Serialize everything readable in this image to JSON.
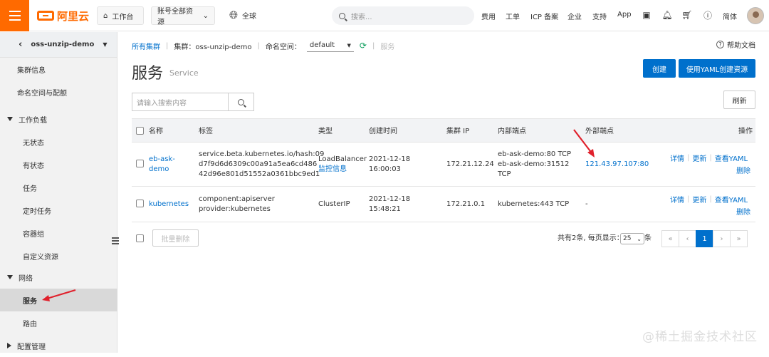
{
  "topbar": {
    "logo_text": "阿里云",
    "workbench": "工作台",
    "account_scope": "账号全部资源",
    "region": "全球",
    "search_placeholder": "搜索...",
    "links": [
      "费用",
      "工单",
      "ICP 备案",
      "企业",
      "支持",
      "App"
    ],
    "lang": "简体"
  },
  "sidebar": {
    "cluster_name": "oss-unzip-demo",
    "items": [
      {
        "label": "集群信息",
        "kind": "top"
      },
      {
        "label": "命名空间与配额",
        "kind": "top"
      },
      {
        "label": "工作负载",
        "kind": "group-open"
      },
      {
        "label": "无状态",
        "kind": "sub"
      },
      {
        "label": "有状态",
        "kind": "sub"
      },
      {
        "label": "任务",
        "kind": "sub"
      },
      {
        "label": "定时任务",
        "kind": "sub"
      },
      {
        "label": "容器组",
        "kind": "sub"
      },
      {
        "label": "自定义资源",
        "kind": "sub"
      },
      {
        "label": "网络",
        "kind": "group-open"
      },
      {
        "label": "服务",
        "kind": "sub-active"
      },
      {
        "label": "路由",
        "kind": "sub"
      },
      {
        "label": "配置管理",
        "kind": "group-closed"
      }
    ]
  },
  "breadcrumb": {
    "all_clusters": "所有集群",
    "cluster_label": "集群：oss-unzip-demo",
    "namespace_label": "命名空间：",
    "namespace_value": "default",
    "current": "服务"
  },
  "help_link": "帮助文档",
  "page": {
    "title": "服务",
    "subtitle": "Service",
    "create_button": "创建",
    "create_yaml_button": "使用YAML创建资源",
    "search_placeholder": "请输入搜索内容",
    "refresh_button": "刷新"
  },
  "table": {
    "headers": [
      "名称",
      "标签",
      "类型",
      "创建时间",
      "集群 IP",
      "内部端点",
      "外部端点",
      "操作"
    ],
    "rows": [
      {
        "name_lines": [
          "eb-ask-",
          "demo"
        ],
        "label_lines": [
          "service.beta.kubernetes.io/hash:09",
          "d7f9d6d6309c00a91a5ea6cd486",
          "42d96e801d51552a0361bbc9ed1"
        ],
        "type": "LoadBalancer",
        "type_link": "监控信息",
        "created_lines": [
          "2021-12-18",
          "16:00:03"
        ],
        "cluster_ip": "172.21.12.24",
        "internal_lines": [
          "eb-ask-demo:80 TCP",
          "eb-ask-demo:31512",
          "TCP"
        ],
        "external": "121.43.97.107:80",
        "actions": [
          "详情",
          "更新",
          "查看YAML"
        ],
        "delete": "删除"
      },
      {
        "name_lines": [
          "kubernetes"
        ],
        "label_lines": [
          "component:apiserver",
          "provider:kubernetes"
        ],
        "type": "ClusterIP",
        "type_link": "",
        "created_lines": [
          "2021-12-18",
          "15:48:21"
        ],
        "cluster_ip": "172.21.0.1",
        "internal_lines": [
          "kubernetes:443 TCP"
        ],
        "external": "-",
        "actions": [
          "详情",
          "更新",
          "查看YAML"
        ],
        "delete": "删除"
      }
    ]
  },
  "footer": {
    "batch_delete": "批量删除",
    "total_text": "共有2条, 每页显示：",
    "page_size": "25",
    "page_size_suffix": "条",
    "pager": [
      "«",
      "‹",
      "1",
      "›",
      "»"
    ],
    "current_page": "1"
  },
  "watermark": "@稀土掘金技术社区",
  "colors": {
    "brand": "#ff6a00",
    "primary": "#0070cc",
    "arrow": "#e0212c"
  }
}
